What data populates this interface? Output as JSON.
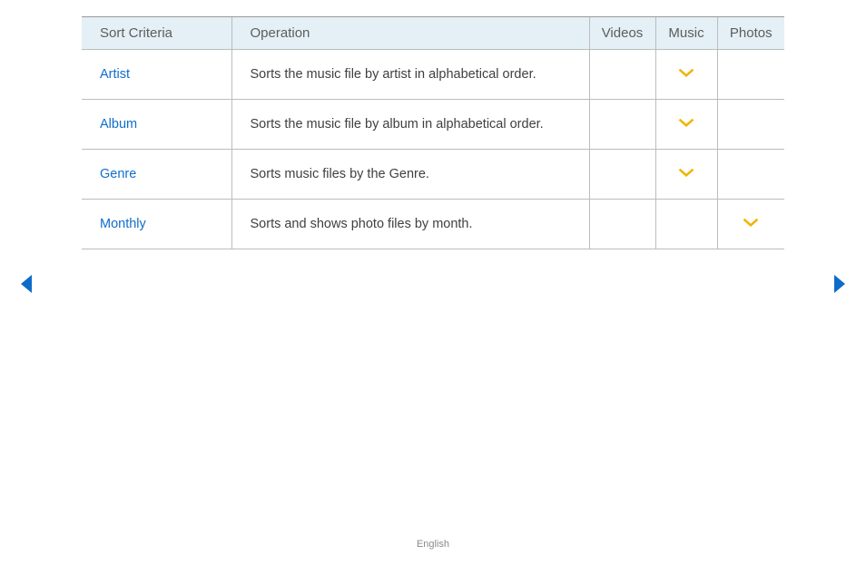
{
  "table": {
    "headers": {
      "criteria": "Sort Criteria",
      "operation": "Operation",
      "videos": "Videos",
      "music": "Music",
      "photos": "Photos"
    },
    "rows": [
      {
        "criteria": "Artist",
        "operation": "Sorts the music file by artist in alphabetical order.",
        "videos": false,
        "music": true,
        "photos": false
      },
      {
        "criteria": "Album",
        "operation": "Sorts the music file by album in alphabetical order.",
        "videos": false,
        "music": true,
        "photos": false
      },
      {
        "criteria": "Genre",
        "operation": "Sorts music files by the Genre.",
        "videos": false,
        "music": true,
        "photos": false
      },
      {
        "criteria": "Monthly",
        "operation": "Sorts and shows photo files by month.",
        "videos": false,
        "music": false,
        "photos": true
      }
    ]
  },
  "footer": {
    "language": "English"
  }
}
